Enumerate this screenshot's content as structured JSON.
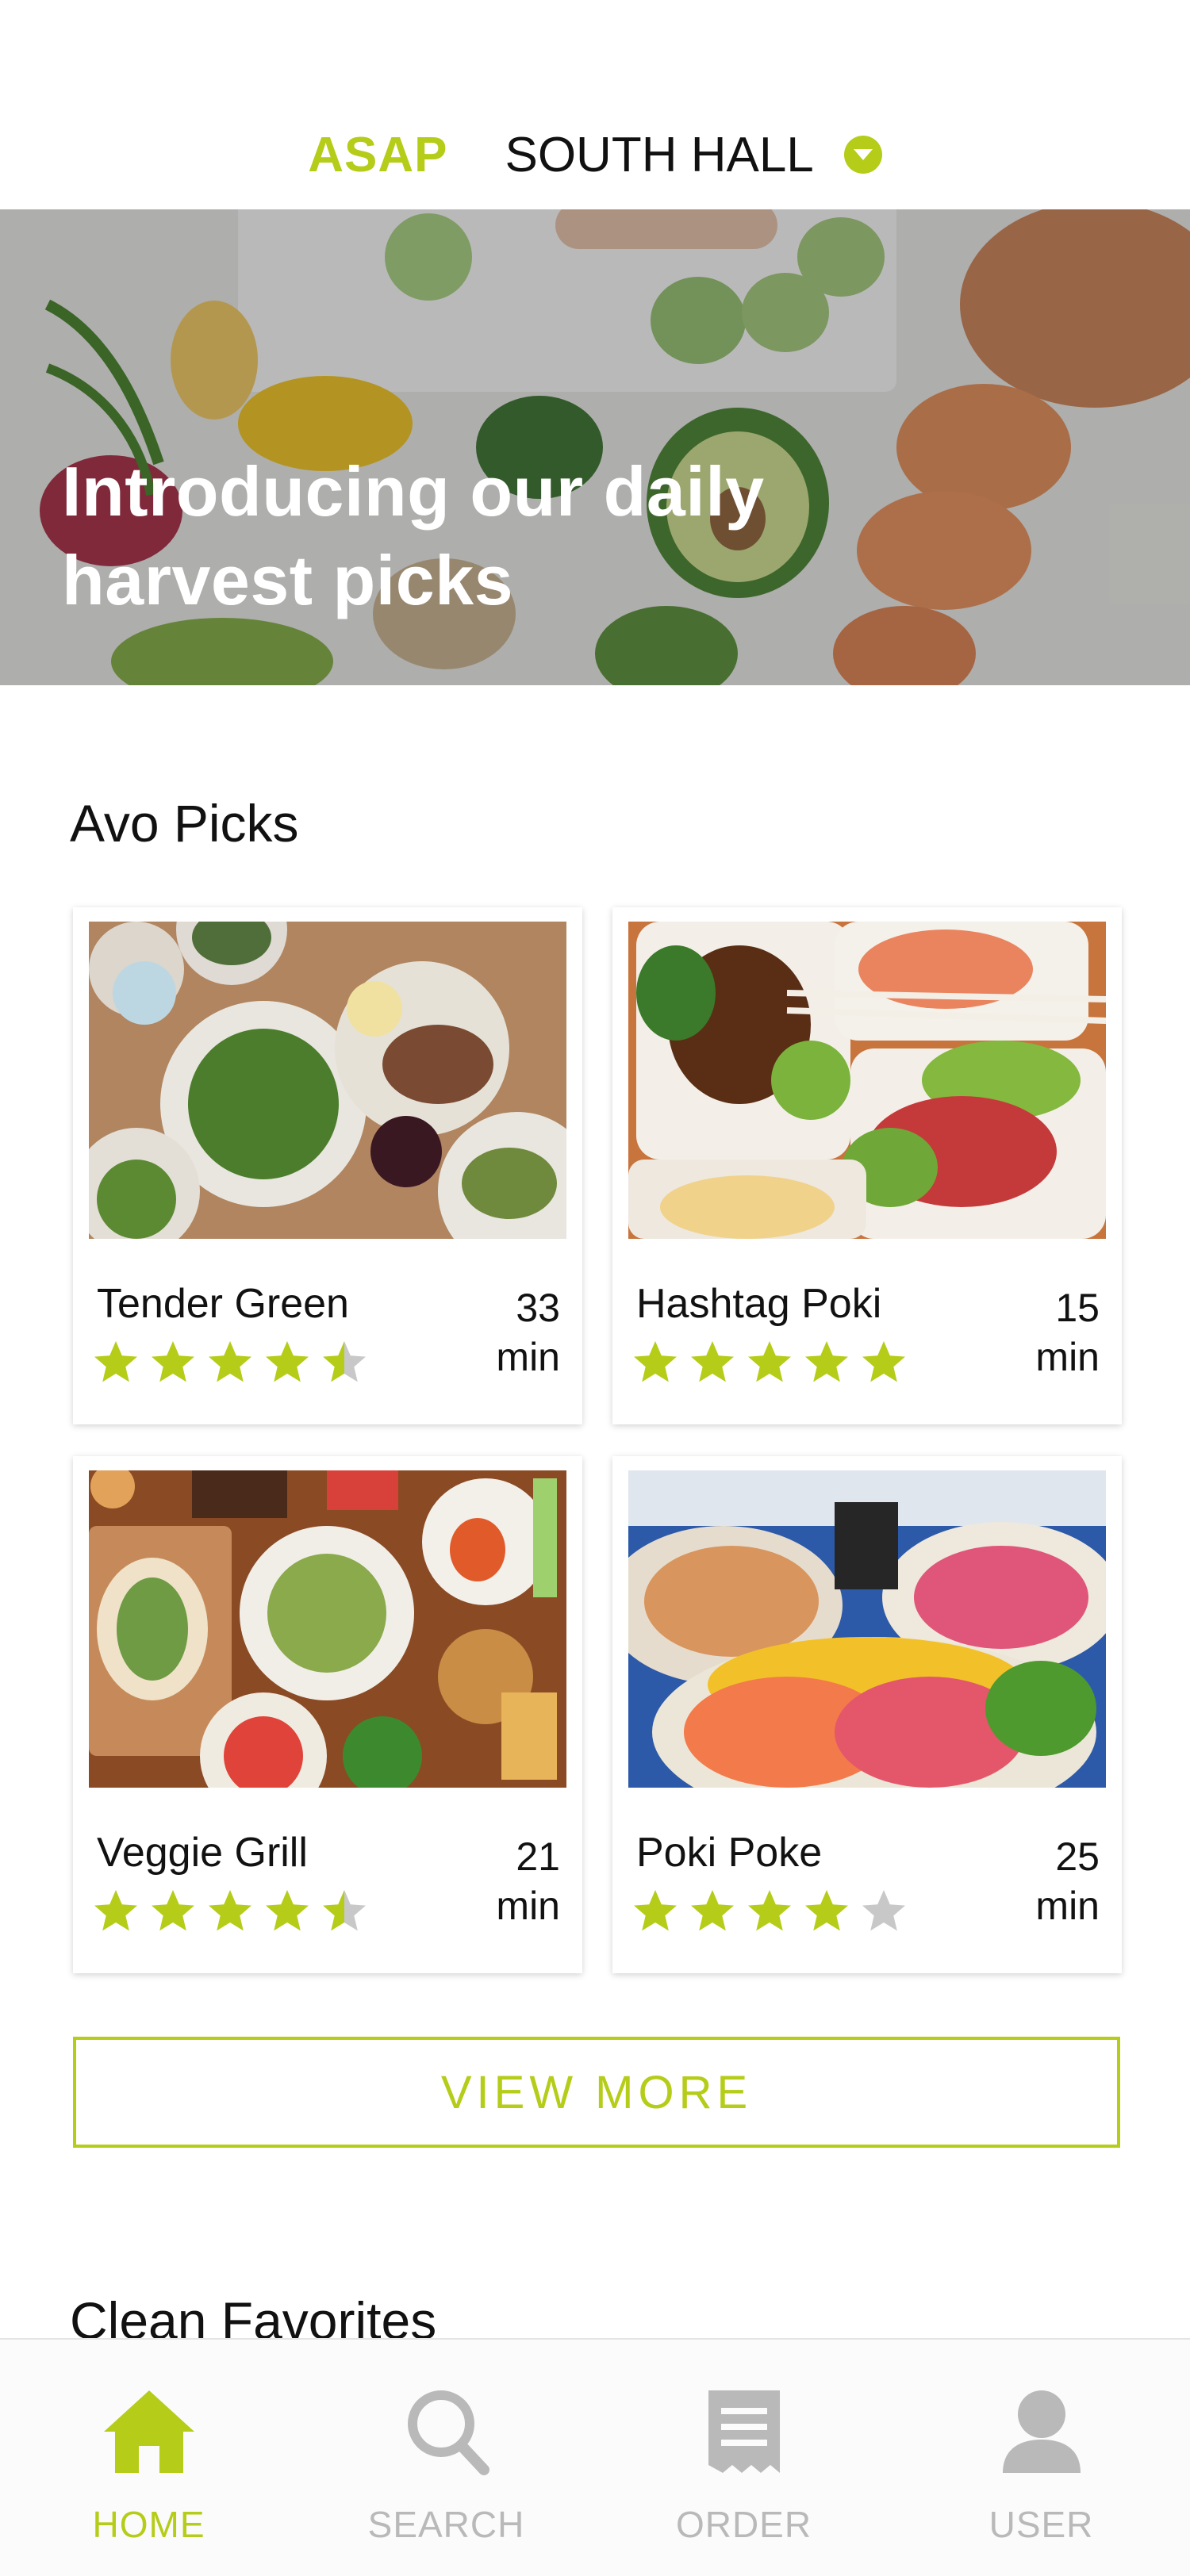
{
  "colors": {
    "accent": "#b5cc18",
    "inactive": "#b9b9b9",
    "star_empty": "#c8c8c8"
  },
  "header": {
    "time_mode": "ASAP",
    "location": "SOUTH HALL",
    "location_icon": "chevron-down-circle-icon"
  },
  "hero": {
    "title_line1": "Introducing our daily",
    "title_line2": "harvest picks"
  },
  "sections": [
    {
      "title": "Avo Picks",
      "restaurants": [
        {
          "name": "Tender Green",
          "time_value": "33",
          "time_unit": "min",
          "rating": 4.5
        },
        {
          "name": "Hashtag Poki",
          "time_value": "15",
          "time_unit": "min",
          "rating": 5
        },
        {
          "name": "Veggie Grill",
          "time_value": "21",
          "time_unit": "min",
          "rating": 4.5
        },
        {
          "name": "Poki Poke",
          "time_value": "25",
          "time_unit": "min",
          "rating": 4
        }
      ],
      "view_more_label": "VIEW MORE"
    },
    {
      "title": "Clean Favorites"
    }
  ],
  "bottom_nav": [
    {
      "label": "HOME",
      "icon": "home-icon",
      "active": true
    },
    {
      "label": "SEARCH",
      "icon": "search-icon",
      "active": false
    },
    {
      "label": "ORDER",
      "icon": "receipt-icon",
      "active": false
    },
    {
      "label": "USER",
      "icon": "user-icon",
      "active": false
    }
  ]
}
